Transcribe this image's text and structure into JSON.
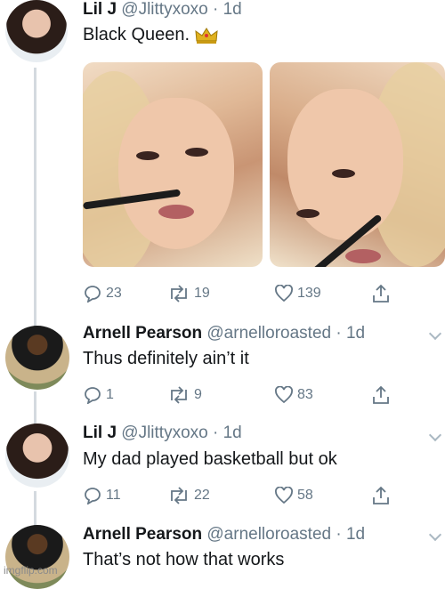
{
  "tweets": [
    {
      "name": "Lil J",
      "handle": "@Jlittyxoxo",
      "time": "1d",
      "text": "Black Queen.",
      "actions": {
        "reply": "23",
        "retweet": "19",
        "like": "139"
      }
    },
    {
      "name": "Arnell Pearson",
      "handle": "@arnelloroasted",
      "time": "1d",
      "text": "Thus definitely ain’t it",
      "actions": {
        "reply": "1",
        "retweet": "9",
        "like": "83"
      }
    },
    {
      "name": "Lil J",
      "handle": "@Jlittyxoxo",
      "time": "1d",
      "text": "My dad played basketball but ok",
      "actions": {
        "reply": "11",
        "retweet": "22",
        "like": "58"
      }
    },
    {
      "name": "Arnell Pearson",
      "handle": "@arnelloroasted",
      "time": "1d",
      "text": "That’s not how that works"
    }
  ],
  "separator": "·",
  "watermark": "imgflip.com",
  "icons": {
    "reply": "reply-icon",
    "retweet": "retweet-icon",
    "like": "heart-icon",
    "share": "share-icon",
    "crown": "crown-emoji",
    "more": "chevron-down-icon"
  },
  "colors": {
    "text": "#14171a",
    "muted": "#657786",
    "thread": "#d4dadf"
  }
}
